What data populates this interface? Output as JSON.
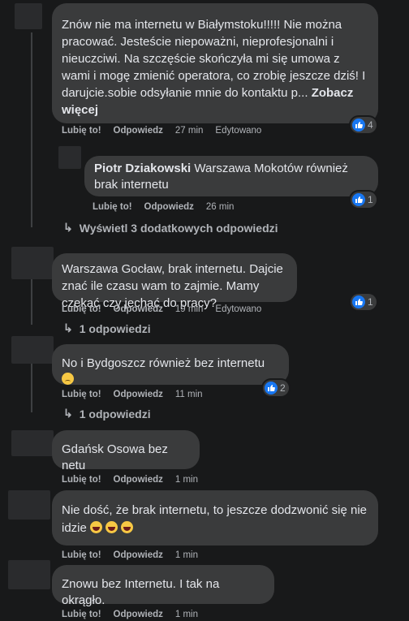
{
  "comments": [
    {
      "text": "Znów nie ma internetu w Białymstoku!!!!! Nie można pracować. Jesteście niepoważni, nieprofesjonalni i nieuczciwi. Na szczęście skończyła mi się umowa z wami i mogę zmienić operatora, co zrobię jeszcze dziś! I darujcie.sobie odsyłanie mnie do kontaktu p...",
      "see_more": "Zobacz więcej",
      "like": "Lubię to!",
      "reply": "Odpowiedz",
      "time": "27 min",
      "edited": "Edytowano",
      "reactions": "4"
    },
    {
      "author": "Piotr Dziakowski",
      "text": "Warszawa Mokotów również brak internetu",
      "like": "Lubię to!",
      "reply": "Odpowiedz",
      "time": "26 min",
      "reactions": "1"
    },
    {
      "text": "Warszawa Gocław, brak internetu. Dajcie znać ile czasu wam to zajmie. Mamy czekać czy jechać do pracy?",
      "like": "Lubię to!",
      "reply": "Odpowiedz",
      "time": "19 min",
      "edited": "Edytowano",
      "reactions": "1"
    },
    {
      "text": "No i Bydgoszcz również bez internetu",
      "like": "Lubię to!",
      "reply": "Odpowiedz",
      "time": "11 min",
      "reactions": "2"
    },
    {
      "text": "Gdańsk Osowa bez netu",
      "like": "Lubię to!",
      "reply": "Odpowiedz",
      "time": "1 min"
    },
    {
      "text": "Nie dość, że brak internetu, to jeszcze dodzwonić się nie idzie",
      "like": "Lubię to!",
      "reply": "Odpowiedz",
      "time": "1 min"
    },
    {
      "text": "Znowu bez Internetu. I tak na okrągło.",
      "like": "Lubię to!",
      "reply": "Odpowiedz",
      "time": "1 min"
    }
  ],
  "replies_links": {
    "more_replies": "Wyświetl 3 dodatkowych odpowiedzi",
    "one_reply_a": "1 odpowiedzi",
    "one_reply_b": "1 odpowiedzi"
  },
  "colors": {
    "background": "#18191a",
    "bubble": "#3a3b3c",
    "like_blue": "#1877f2",
    "secondary_text": "#b0b3b8"
  }
}
